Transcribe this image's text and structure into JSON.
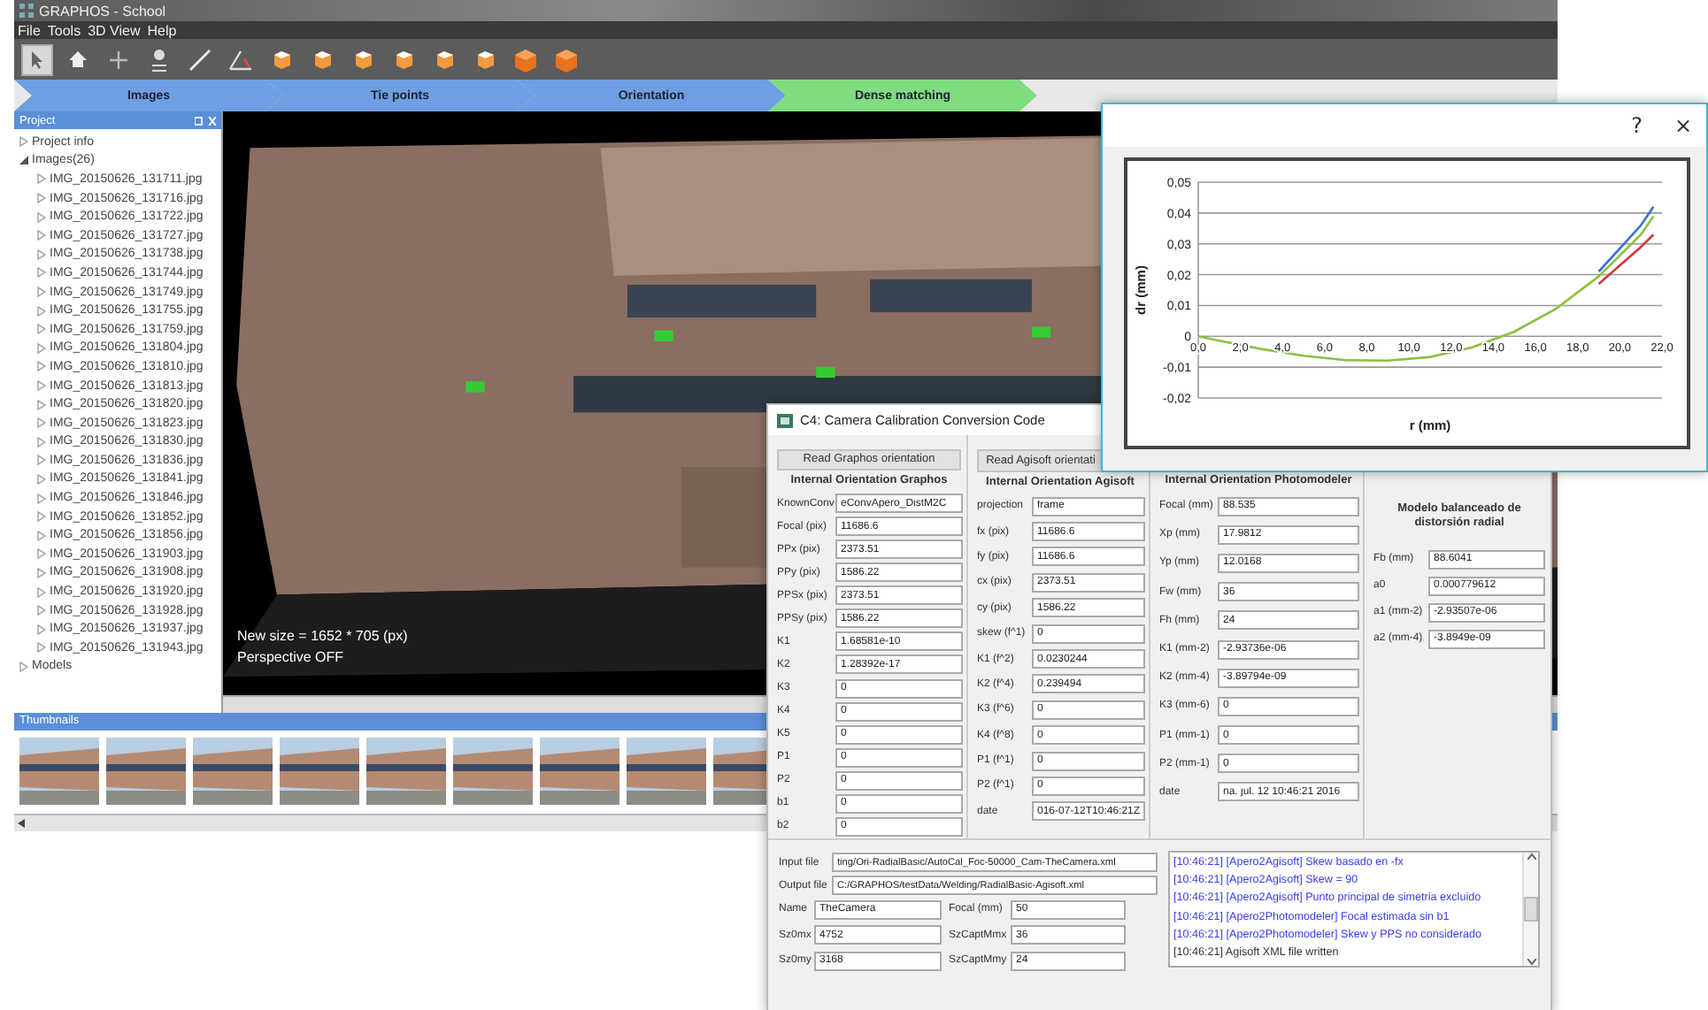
{
  "main_window": {
    "title": "GRAPHOS - School",
    "menu": [
      "File",
      "Tools",
      "3D View",
      "Help"
    ],
    "toolbar": [
      {
        "kind": "pointer",
        "selected": true
      },
      {
        "kind": "home",
        "selected": false
      },
      {
        "kind": "plus",
        "selected": false
      },
      {
        "kind": "point",
        "selected": false
      },
      {
        "kind": "ruler",
        "selected": false
      },
      {
        "kind": "angle",
        "selected": false
      },
      {
        "kind": "cube",
        "selected": false
      },
      {
        "kind": "cube",
        "selected": false
      },
      {
        "kind": "cube",
        "selected": false
      },
      {
        "kind": "cube",
        "selected": false
      },
      {
        "kind": "cube",
        "selected": false
      },
      {
        "kind": "cube",
        "selected": false
      },
      {
        "kind": "orange-cube",
        "selected": false
      },
      {
        "kind": "orange-cube",
        "selected": false
      }
    ],
    "workflow": [
      {
        "label": "Images",
        "color": "#6d9fe2"
      },
      {
        "label": "Tie points",
        "color": "#6d9fe2"
      },
      {
        "label": "Orientation",
        "color": "#6d9fe2"
      },
      {
        "label": "Dense matching",
        "color": "#7fdc7f"
      }
    ],
    "project_panel": {
      "title": "Project",
      "tree": [
        {
          "label": "Project info",
          "expanded": false
        },
        {
          "label": "Images(26)",
          "expanded": true,
          "children": [
            {
              "label": "IMG_20150626_131711.jpg",
              "expanded": false
            },
            {
              "label": "IMG_20150626_131716.jpg",
              "expanded": false
            },
            {
              "label": "IMG_20150626_131722.jpg",
              "expanded": false
            },
            {
              "label": "IMG_20150626_131727.jpg",
              "expanded": false
            },
            {
              "label": "IMG_20150626_131738.jpg",
              "expanded": false
            },
            {
              "label": "IMG_20150626_131744.jpg",
              "expanded": false
            },
            {
              "label": "IMG_20150626_131749.jpg",
              "expanded": false
            },
            {
              "label": "IMG_20150626_131755.jpg",
              "expanded": false
            },
            {
              "label": "IMG_20150626_131759.jpg",
              "expanded": false
            },
            {
              "label": "IMG_20150626_131804.jpg",
              "expanded": false
            },
            {
              "label": "IMG_20150626_131810.jpg",
              "expanded": false
            },
            {
              "label": "IMG_20150626_131813.jpg",
              "expanded": false
            },
            {
              "label": "IMG_20150626_131820.jpg",
              "expanded": false
            },
            {
              "label": "IMG_20150626_131823.jpg",
              "expanded": false
            },
            {
              "label": "IMG_20150626_131830.jpg",
              "expanded": false
            },
            {
              "label": "IMG_20150626_131836.jpg",
              "expanded": false
            },
            {
              "label": "IMG_20150626_131841.jpg",
              "expanded": false
            },
            {
              "label": "IMG_20150626_131846.jpg",
              "expanded": false
            },
            {
              "label": "IMG_20150626_131852.jpg",
              "expanded": false
            },
            {
              "label": "IMG_20150626_131856.jpg",
              "expanded": false
            },
            {
              "label": "IMG_20150626_131903.jpg",
              "expanded": false
            },
            {
              "label": "IMG_20150626_131908.jpg",
              "expanded": false
            },
            {
              "label": "IMG_20150626_131920.jpg",
              "expanded": false
            },
            {
              "label": "IMG_20150626_131928.jpg",
              "expanded": false
            },
            {
              "label": "IMG_20150626_131937.jpg",
              "expanded": false
            },
            {
              "label": "IMG_20150626_131943.jpg",
              "expanded": false
            }
          ]
        },
        {
          "label": "Models",
          "expanded": false
        }
      ]
    },
    "viewport": {
      "kind": "picture",
      "overlay": [
        "New size = 1652 * 705 (px)",
        "Perspective OFF"
      ]
    },
    "thumbnails_panel": {
      "title": "Thumbnails"
    }
  },
  "chart_dialog": {
    "help": "?",
    "close": "×",
    "chart_data": {
      "type": "line",
      "xlabel": "r (mm)",
      "ylabel": "dr (mm)",
      "x": [
        0,
        1,
        3,
        5,
        7,
        9,
        11,
        13,
        15,
        17,
        19,
        21,
        21.6
      ],
      "series": [
        {
          "color": "#8cc040",
          "values": [
            0,
            -0.0014,
            -0.0041,
            -0.0063,
            -0.0077,
            -0.0079,
            -0.0067,
            -0.0036,
            0.0015,
            0.0091,
            0.0195,
            0.033,
            0.039
          ]
        },
        {
          "color": "#d03a3a",
          "values": [
            null,
            null,
            null,
            null,
            null,
            null,
            null,
            null,
            null,
            null,
            0.017,
            0.029,
            0.033
          ]
        },
        {
          "color": "#3a6fd8",
          "values": [
            null,
            null,
            null,
            null,
            null,
            null,
            null,
            null,
            null,
            null,
            0.021,
            0.036,
            0.042
          ]
        }
      ],
      "grid": true,
      "xlim": [
        0,
        22
      ],
      "ylim": [
        -0.02,
        0.05
      ],
      "xticks": [
        {
          "value": 0,
          "label": "0,0"
        },
        {
          "value": 2,
          "label": "2,0"
        },
        {
          "value": 4,
          "label": "4,0"
        },
        {
          "value": 6,
          "label": "6,0"
        },
        {
          "value": 8,
          "label": "8,0"
        },
        {
          "value": 10,
          "label": "10,0"
        },
        {
          "value": 12,
          "label": "12,0"
        },
        {
          "value": 14,
          "label": "14,0"
        },
        {
          "value": 16,
          "label": "16,0"
        },
        {
          "value": 18,
          "label": "18,0"
        },
        {
          "value": 20,
          "label": "20,0"
        },
        {
          "value": 22,
          "label": "22,0"
        }
      ],
      "yticks": [
        {
          "value": 0.05,
          "label": "0,05"
        },
        {
          "value": 0.04,
          "label": "0,04"
        },
        {
          "value": 0.03,
          "label": "0,03"
        },
        {
          "value": 0.02,
          "label": "0,02"
        },
        {
          "value": 0.01,
          "label": "0,01"
        },
        {
          "value": 0,
          "label": "0"
        },
        {
          "value": -0.01,
          "label": "-0,01"
        },
        {
          "value": -0.02,
          "label": "-0,02"
        }
      ]
    }
  },
  "calibration_dialog": {
    "title": "C4: Camera Calibration Conversion Code",
    "graphos": {
      "button": "Read Graphos orientation",
      "header": "Internal Orientation Graphos",
      "fields": [
        {
          "label": "KnownConv",
          "value": "eConvApero_DistM2C"
        },
        {
          "label": "Focal (pix)",
          "value": "11686.6"
        },
        {
          "label": "PPx (pix)",
          "value": "2373.51"
        },
        {
          "label": "PPy (pix)",
          "value": "1586.22"
        },
        {
          "label": "PPSx (pix)",
          "value": "2373.51"
        },
        {
          "label": "PPSy (pix)",
          "value": "1586.22"
        },
        {
          "label": "K1",
          "value": "1.68581e-10"
        },
        {
          "label": "K2",
          "value": "1.28392e-17"
        },
        {
          "label": "K3",
          "value": "0"
        },
        {
          "label": "K4",
          "value": "0"
        },
        {
          "label": "K5",
          "value": "0"
        },
        {
          "label": "P1",
          "value": "0"
        },
        {
          "label": "P2",
          "value": "0"
        },
        {
          "label": "b1",
          "value": "0"
        },
        {
          "label": "b2",
          "value": "0"
        }
      ]
    },
    "agisoft": {
      "button": "Read Agisoft orientati",
      "header": "Internal Orientation Agisoft",
      "fields": [
        {
          "label": "projection",
          "value": "frame"
        },
        {
          "label": "fx (pix)",
          "value": "11686.6"
        },
        {
          "label": "fy (pix)",
          "value": "11686.6"
        },
        {
          "label": "cx (pix)",
          "value": "2373.51"
        },
        {
          "label": "cy (pix)",
          "value": "1586.22"
        },
        {
          "label": "skew (f^1)",
          "value": "0"
        },
        {
          "label": "K1 (f^2)",
          "value": "0.0230244"
        },
        {
          "label": "K2 (f^4)",
          "value": "0.239494"
        },
        {
          "label": "K3 (f^6)",
          "value": "0"
        },
        {
          "label": "K4 (f^8)",
          "value": "0"
        },
        {
          "label": "P1 (f^1)",
          "value": "0"
        },
        {
          "label": "P2 (f^1)",
          "value": "0"
        },
        {
          "label": "date",
          "value": "016-07-12T10:46:21Z"
        }
      ]
    },
    "photomodeler": {
      "header": "Internal Orientation Photomodeler",
      "fields": [
        {
          "label": "Focal (mm)",
          "value": "88.535"
        },
        {
          "label": "Xp (mm)",
          "value": "17.9812"
        },
        {
          "label": "Yp (mm)",
          "value": "12.0168"
        },
        {
          "label": "Fw (mm)",
          "value": "36"
        },
        {
          "label": "Fh (mm)",
          "value": "24"
        },
        {
          "label": "K1 (mm-2)",
          "value": "-2.93736e-06"
        },
        {
          "label": "K2 (mm-4)",
          "value": "-3.89794e-09"
        },
        {
          "label": "K3 (mm-6)",
          "value": "0"
        },
        {
          "label": "P1 (mm-1)",
          "value": "0"
        },
        {
          "label": "P2 (mm-1)",
          "value": "0"
        },
        {
          "label": "date",
          "value": "na. jul. 12 10:46:21 2016"
        }
      ]
    },
    "balanced_model": {
      "header": "Modelo balanceado de distorsión radial",
      "fields": [
        {
          "label": "Fb (mm)",
          "value": "88.6041"
        },
        {
          "label": "a0",
          "value": "0.000779612"
        },
        {
          "label": "a1 (mm-2)",
          "value": "-2.93507e-06"
        },
        {
          "label": "a2 (mm-4)",
          "value": "-3.8949e-09"
        }
      ]
    },
    "files": [
      {
        "label": "Input file",
        "value": "ting/Ori-RadialBasic/AutoCal_Foc-50000_Cam-TheCamera.xml"
      },
      {
        "label": "Output file",
        "value": "C:/GRAPHOS/testData/Welding/RadialBasic-Agisoft.xml"
      }
    ],
    "camera": [
      {
        "label": "Name",
        "value": "TheCamera"
      },
      {
        "label": "Focal (mm)",
        "value": "50"
      },
      {
        "label": "Sz0mx",
        "value": "4752"
      },
      {
        "label": "SzCaptMmx",
        "value": "36"
      },
      {
        "label": "Sz0my",
        "value": "3168"
      },
      {
        "label": "SzCaptMmy",
        "value": "24"
      }
    ],
    "log": [
      {
        "text": "[10:46:21] [Apero2Agisoft] Skew basado en -fx",
        "color": "#3b3bf0"
      },
      {
        "text": "[10:46:21] [Apero2Agisoft] Skew = 90",
        "color": "#3b3bf0"
      },
      {
        "text": "[10:46:21] [Apero2Agisoft] Punto principal de simetria excluido",
        "color": "#3b3bf0"
      },
      {
        "text": "[10:46:21] [Apero2Photomodeler] Focal estimada sin b1",
        "color": "#3b3bf0"
      },
      {
        "text": "[10:46:21] [Apero2Photomodeler] Skew y PPS no considerado",
        "color": "#3b3bf0"
      },
      {
        "text": "[10:46:21] Agisoft XML file written",
        "color": "#333333"
      }
    ]
  }
}
